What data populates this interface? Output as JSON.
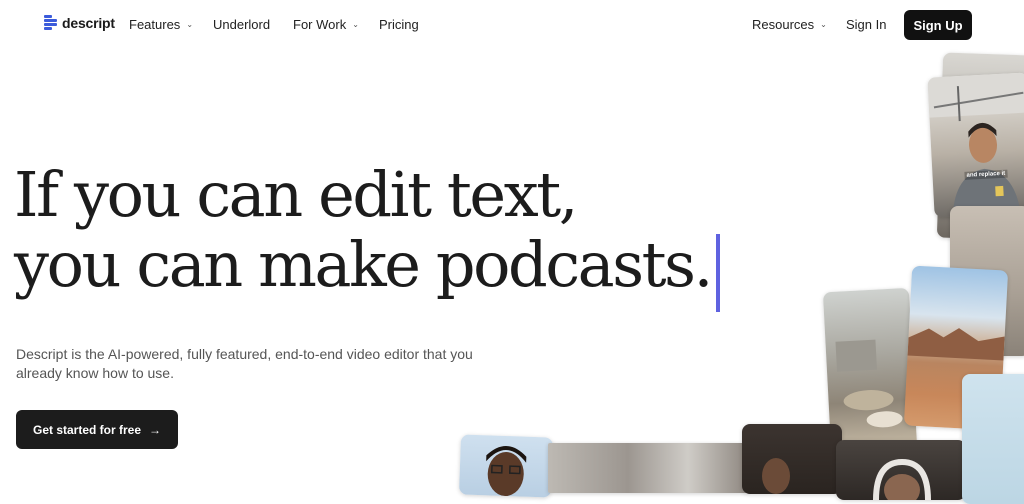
{
  "brand": {
    "name": "descript",
    "accent": "#3b5bdb"
  },
  "nav": {
    "features": "Features",
    "underlord": "Underlord",
    "for_work": "For Work",
    "pricing": "Pricing",
    "resources": "Resources",
    "sign_in": "Sign In",
    "sign_up": "Sign Up"
  },
  "hero": {
    "headline_line1": "If you can edit text,",
    "headline_line2": "you can make podcasts.",
    "subtext": "Descript is the AI-powered, fully featured, end-to-end video editor that you already know how to use.",
    "cta_label": "Get started for free",
    "cta_icon": "arrow-right-icon",
    "cursor_color": "#5f62e0"
  },
  "collage": {
    "video_caption": "and replace it"
  }
}
